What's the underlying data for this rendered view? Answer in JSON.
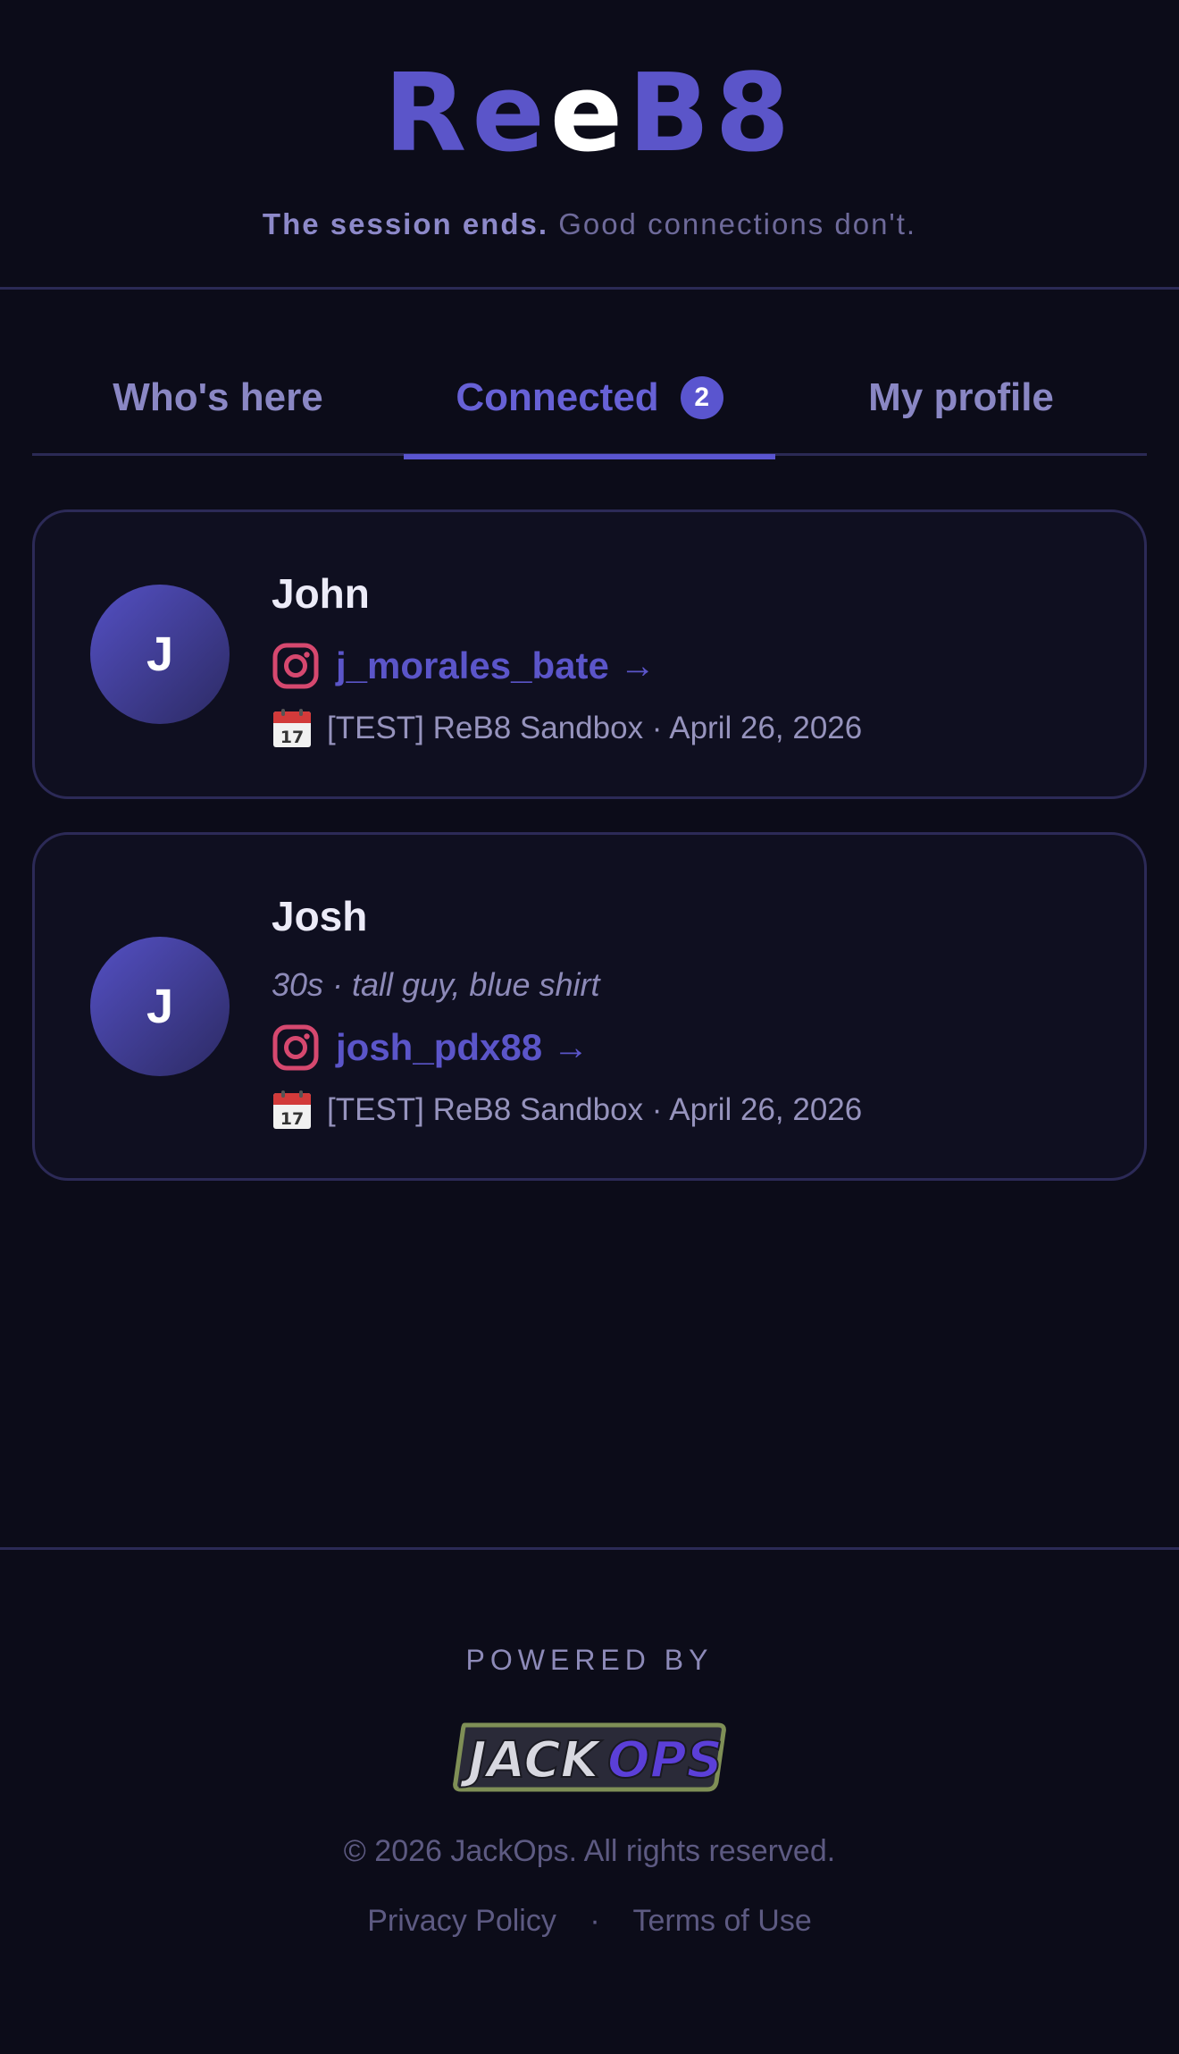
{
  "header": {
    "logo_part1": "Re",
    "logo_part2": "B8",
    "tagline_strong": "The session ends.",
    "tagline_rest": "Good connections don't."
  },
  "tabs": [
    {
      "label": "Who's here",
      "active": false
    },
    {
      "label": "Connected",
      "active": true,
      "badge": "2"
    },
    {
      "label": "My profile",
      "active": false
    }
  ],
  "connections": [
    {
      "initial": "J",
      "name": "John",
      "instagram": "j_morales_bate",
      "arrow": "→",
      "calendar_icon": "calendar-icon",
      "event": "[TEST] ReB8 Sandbox · April 26, 2026"
    },
    {
      "initial": "J",
      "name": "Josh",
      "description": "30s · tall guy, blue shirt",
      "instagram": "josh_pdx88",
      "arrow": "→",
      "calendar_icon": "calendar-icon",
      "event": "[TEST] ReB8 Sandbox · April 26, 2026"
    }
  ],
  "footer": {
    "powered_by": "POWERED BY",
    "brand_part1": "JACK",
    "brand_part2": "OPS",
    "copyright": "© 2026 JackOps. All rights reserved.",
    "privacy": "Privacy Policy",
    "separator": "·",
    "terms": "Terms of Use"
  },
  "colors": {
    "background": "#0c0c19",
    "accent": "#5a55cf",
    "card_border": "#2c2a57",
    "instagram_icon": "#d6486f"
  }
}
